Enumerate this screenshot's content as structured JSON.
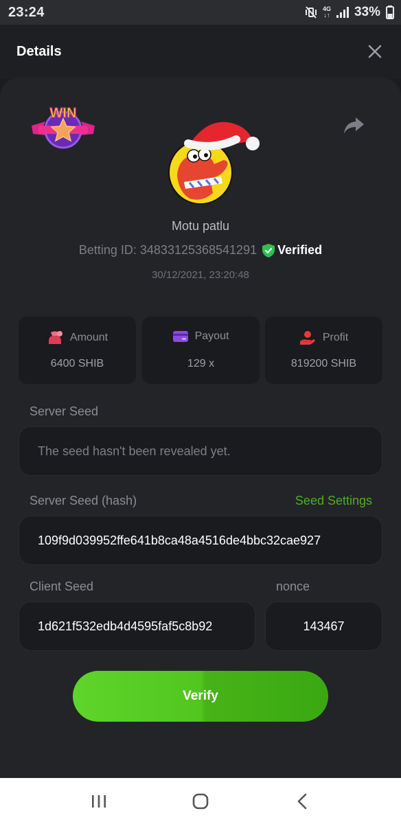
{
  "status_bar": {
    "time": "23:24",
    "network_top": "4G",
    "network_bottom": "↓↑",
    "battery": "33%"
  },
  "header": {
    "title": "Details"
  },
  "badge": {
    "text": "WIN"
  },
  "player": {
    "name": "Motu patlu",
    "betting_id": "Betting ID: 34833125368541291",
    "verified_label": "Verified",
    "datetime": "30/12/2021, 23:20:48"
  },
  "stats": {
    "amount": {
      "label": "Amount",
      "value": "6400 SHIB"
    },
    "payout": {
      "label": "Payout",
      "value": "129 x"
    },
    "profit": {
      "label": "Profit",
      "value": "819200 SHIB"
    }
  },
  "server_seed": {
    "label": "Server Seed",
    "value": "The seed hasn't been revealed yet."
  },
  "server_seed_hash": {
    "label": "Server Seed (hash)",
    "settings_link": "Seed Settings",
    "value": "109f9d039952ffe641b8ca48a4516de4bbc32cae927"
  },
  "client_seed": {
    "label": "Client Seed",
    "value": "1d621f532edb4d4595faf5c8b92"
  },
  "nonce": {
    "label": "nonce",
    "value": "143467"
  },
  "verify_button": "Verify",
  "colors": {
    "accent_green": "#4ab11f",
    "verified_green": "#2fbf4f",
    "background": "#232428",
    "field_bg": "#1a1b1e"
  }
}
